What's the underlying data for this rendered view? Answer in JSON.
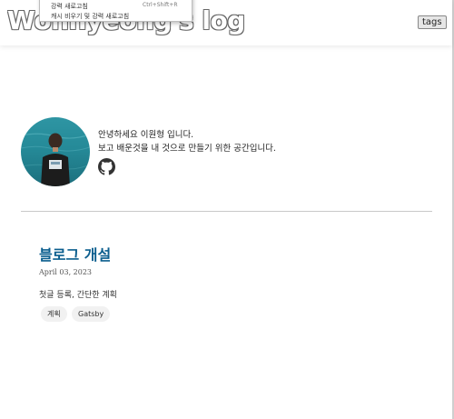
{
  "header": {
    "site_title": "Wonhyeong's log",
    "tags_button": "tags"
  },
  "context_menu": {
    "item_1": "강력 새로고침",
    "item_1_shortcut": "Ctrl+Shift+R",
    "item_2": "캐시 비우기 및 강력 새로고침"
  },
  "profile": {
    "bio_line_1": "안녕하세요 이원형 입니다.",
    "bio_line_2": "보고 배운것을 내 것으로 만들기 위한 공간입니다.",
    "github_icon": "github-icon"
  },
  "posts": [
    {
      "title": "블로그 개설",
      "date": "April 03, 2023",
      "summary": "첫글 등록, 간단한 계획",
      "tags": [
        "계획",
        "Gatsby"
      ]
    }
  ],
  "colors": {
    "post_title": "#0b5e8e",
    "tag_background": "#f1f1f1",
    "divider": "#c8c8c8"
  }
}
